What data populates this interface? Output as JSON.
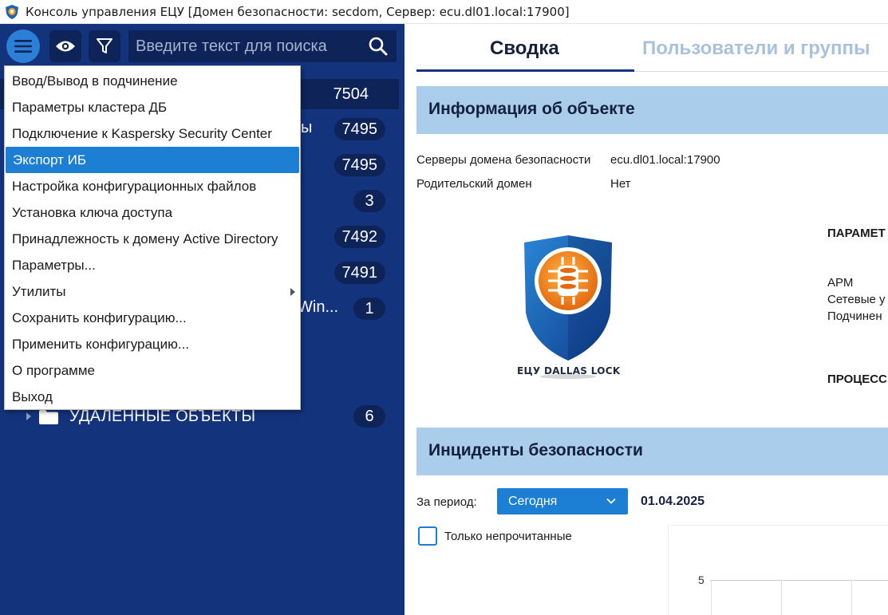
{
  "window": {
    "title": "Консоль управления ЕЦУ [Домен безопасности: secdom, Сервер: ecu.dl01.local:17900]"
  },
  "toolbar": {
    "search_placeholder": "Введите текст для поиска"
  },
  "tree": {
    "rows": [
      {
        "count": "7504",
        "tail": ""
      },
      {
        "count": "7495",
        "tail": "ы"
      },
      {
        "count": "7495",
        "tail": ""
      },
      {
        "count": "3",
        "tail": ""
      },
      {
        "count": "7492",
        "tail": ""
      },
      {
        "count": "7491",
        "tail": ""
      },
      {
        "count": "1",
        "tail": "Win..."
      }
    ],
    "deleted": {
      "label": "УДАЛЁННЫЕ ОБЪЕКТЫ",
      "count": "6"
    }
  },
  "menu": {
    "items": [
      {
        "label": "Ввод/Вывод в подчинение"
      },
      {
        "label": "Параметры кластера ДБ"
      },
      {
        "label": "Подключение к Kaspersky Security Center"
      },
      {
        "label": "Экспорт ИБ",
        "highlighted": true
      },
      {
        "label": "Настройка конфигурационных файлов"
      },
      {
        "label": "Установка ключа доступа"
      },
      {
        "label": "Принадлежность к домену Active Directory"
      },
      {
        "label": "Параметры..."
      },
      {
        "label": "Утилиты",
        "submenu": true
      },
      {
        "label": "Сохранить конфигурацию..."
      },
      {
        "label": "Применить конфигурацию..."
      },
      {
        "label": "О программе"
      },
      {
        "label": "Выход"
      }
    ]
  },
  "tabs": {
    "summary": "Сводка",
    "users": "Пользователи и группы"
  },
  "object_info": {
    "header": "Информация об объекте",
    "servers_label": "Серверы домена безопасности",
    "servers_value": "ecu.dl01.local:17900",
    "parent_label": "Родительский домен",
    "parent_value": "Нет",
    "logo_caption": "ЕЦУ DALLAS LOCK",
    "params_heading": "ПАРАМЕТ",
    "params_lines": [
      "АРМ",
      "Сетевые у",
      "Подчинен"
    ],
    "process_heading": "ПРОЦЕСС"
  },
  "incidents": {
    "header": "Инциденты безопасности",
    "period_label": "За период:",
    "period_value": "Сегодня",
    "date": "01.04.2025",
    "unread_only_label": "Только непрочитанные",
    "chart_tick": "5"
  },
  "colors": {
    "left_panel": "#14337d",
    "accent": "#1c7fd3",
    "section_header": "#a9cdea"
  }
}
